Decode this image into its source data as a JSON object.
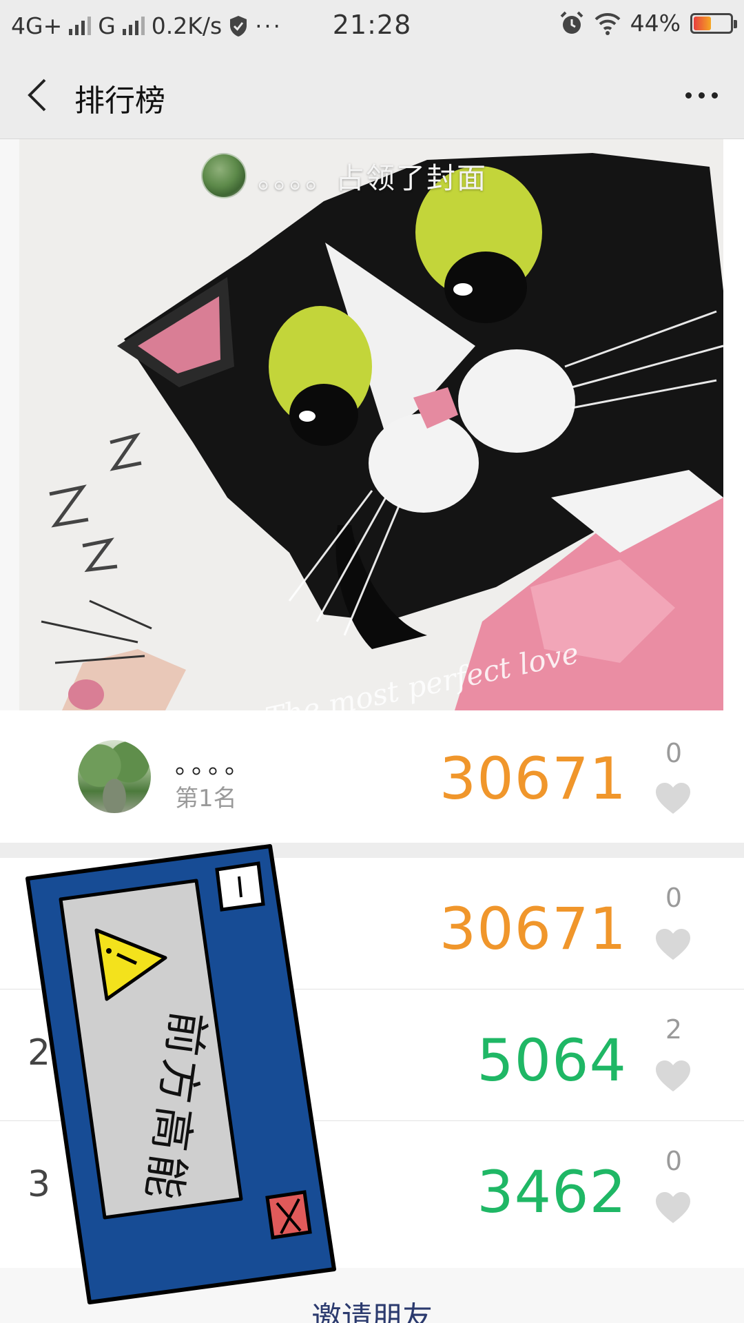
{
  "status_bar": {
    "network1": "4G+",
    "network2": "G",
    "speed": "0.2K/s",
    "more": "···",
    "time": "21:28",
    "battery": "44%",
    "battery_level": 0.44
  },
  "nav": {
    "title": "排行榜"
  },
  "cover": {
    "caption_name": "。。。。",
    "caption_action": "占领了封面",
    "artwork_text": "The most perfect love"
  },
  "top_entry": {
    "name": "。。。。",
    "rank_label": "第1名",
    "steps": "30671",
    "likes": "0"
  },
  "ranking": [
    {
      "rank": "",
      "steps": "30671",
      "likes": "0",
      "color": "#f0962b"
    },
    {
      "rank": "2",
      "steps": "5064",
      "likes": "2",
      "color": "#1fb765"
    },
    {
      "rank": "3",
      "steps": "3462",
      "likes": "0",
      "color": "#1fb765"
    }
  ],
  "sticker": {
    "text": "前方高能"
  },
  "footer": {
    "invite_label": "邀请朋友"
  }
}
